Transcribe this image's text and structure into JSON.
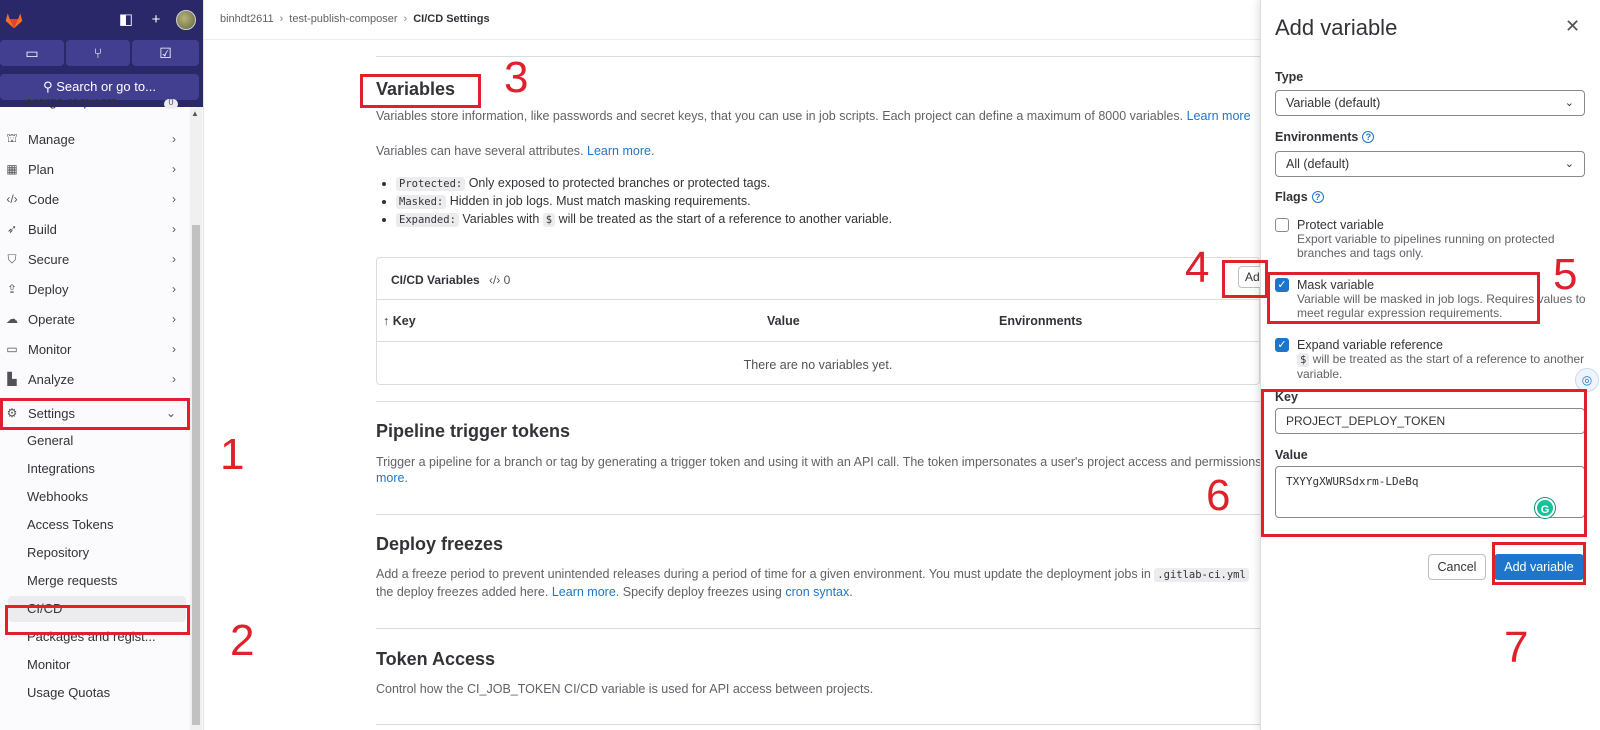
{
  "sidebar": {
    "search_label": "Search or go to...",
    "partial_item": "Merge requests",
    "partial_badge": "0",
    "items": [
      {
        "label": "Manage",
        "icon": "users-icon"
      },
      {
        "label": "Plan",
        "icon": "calendar-icon"
      },
      {
        "label": "Code",
        "icon": "code-icon"
      },
      {
        "label": "Build",
        "icon": "rocket-icon"
      },
      {
        "label": "Secure",
        "icon": "shield-icon"
      },
      {
        "label": "Deploy",
        "icon": "deploy-icon"
      },
      {
        "label": "Operate",
        "icon": "cloud-icon"
      },
      {
        "label": "Monitor",
        "icon": "monitor-icon"
      },
      {
        "label": "Analyze",
        "icon": "chart-icon"
      }
    ],
    "settings_label": "Settings",
    "settings_sub": [
      "General",
      "Integrations",
      "Webhooks",
      "Access Tokens",
      "Repository",
      "Merge requests",
      "CI/CD",
      "Packages and regist...",
      "Monitor",
      "Usage Quotas"
    ]
  },
  "breadcrumb": {
    "user": "binhdt2611",
    "project": "test-publish-composer",
    "page": "CI/CD Settings"
  },
  "variables": {
    "title": "Variables",
    "desc": "Variables store information, like passwords and secret keys, that you can use in job scripts. Each project can define a maximum of 8000 variables.",
    "learn_more": "Learn more",
    "attrs_intro": "Variables can have several attributes.",
    "attrs_learn_more": "Learn more.",
    "bullets": [
      {
        "code": "Protected:",
        "text": "Only exposed to protected branches or protected tags."
      },
      {
        "code": "Masked:",
        "text": "Hidden in job logs. Must match masking requirements."
      },
      {
        "code": "Expanded:",
        "text_pre": "Variables with",
        "code2": "$",
        "text_post": "will be treated as the start of a reference to another variable."
      }
    ],
    "card_title": "CI/CD Variables",
    "card_count": "0",
    "add_label": "Add variable",
    "col_key": "Key",
    "col_value": "Value",
    "col_env": "Environments",
    "empty": "There are no variables yet."
  },
  "trigger": {
    "title": "Pipeline trigger tokens",
    "desc": "Trigger a pipeline for a branch or tag by generating a trigger token and using it with an API call. The token impersonates a user's project access and permissions.",
    "learn_more_tail": "more."
  },
  "freeze": {
    "title": "Deploy freezes",
    "desc_pre": "Add a freeze period to prevent unintended releases during a period of time for a given environment. You must update the deployment jobs in",
    "code": ".gitlab-ci.yml",
    "line2_pre": "the deploy freezes added here.",
    "learn_more": "Learn more.",
    "line2_mid": "Specify deploy freezes using",
    "cron": "cron syntax",
    "line2_end": "."
  },
  "token_access": {
    "title": "Token Access",
    "desc": "Control how the CI_JOB_TOKEN CI/CD variable is used for API access between projects."
  },
  "drawer": {
    "title": "Add variable",
    "type_label": "Type",
    "type_value": "Variable (default)",
    "env_label": "Environments",
    "env_value": "All (default)",
    "flags_label": "Flags",
    "protect_label": "Protect variable",
    "protect_help": "Export variable to pipelines running on protected branches and tags only.",
    "protect_checked": false,
    "mask_label": "Mask variable",
    "mask_help": "Variable will be masked in job logs. Requires values to meet regular expression requirements.",
    "mask_checked": true,
    "expand_label": "Expand variable reference",
    "expand_code": "$",
    "expand_help": "will be treated as the start of a reference to another variable.",
    "expand_checked": true,
    "key_label": "Key",
    "key_value": "PROJECT_DEPLOY_TOKEN",
    "value_label": "Value",
    "value_value": "TXYYgXWURSdxrm-LDeBq",
    "cancel": "Cancel",
    "submit": "Add variable"
  },
  "annotations": [
    "1",
    "2",
    "3",
    "4",
    "5",
    "6",
    "7"
  ],
  "colors": {
    "annotation": "#e0202a",
    "primary": "#1f75cb",
    "nav_top": "#2a2868"
  }
}
